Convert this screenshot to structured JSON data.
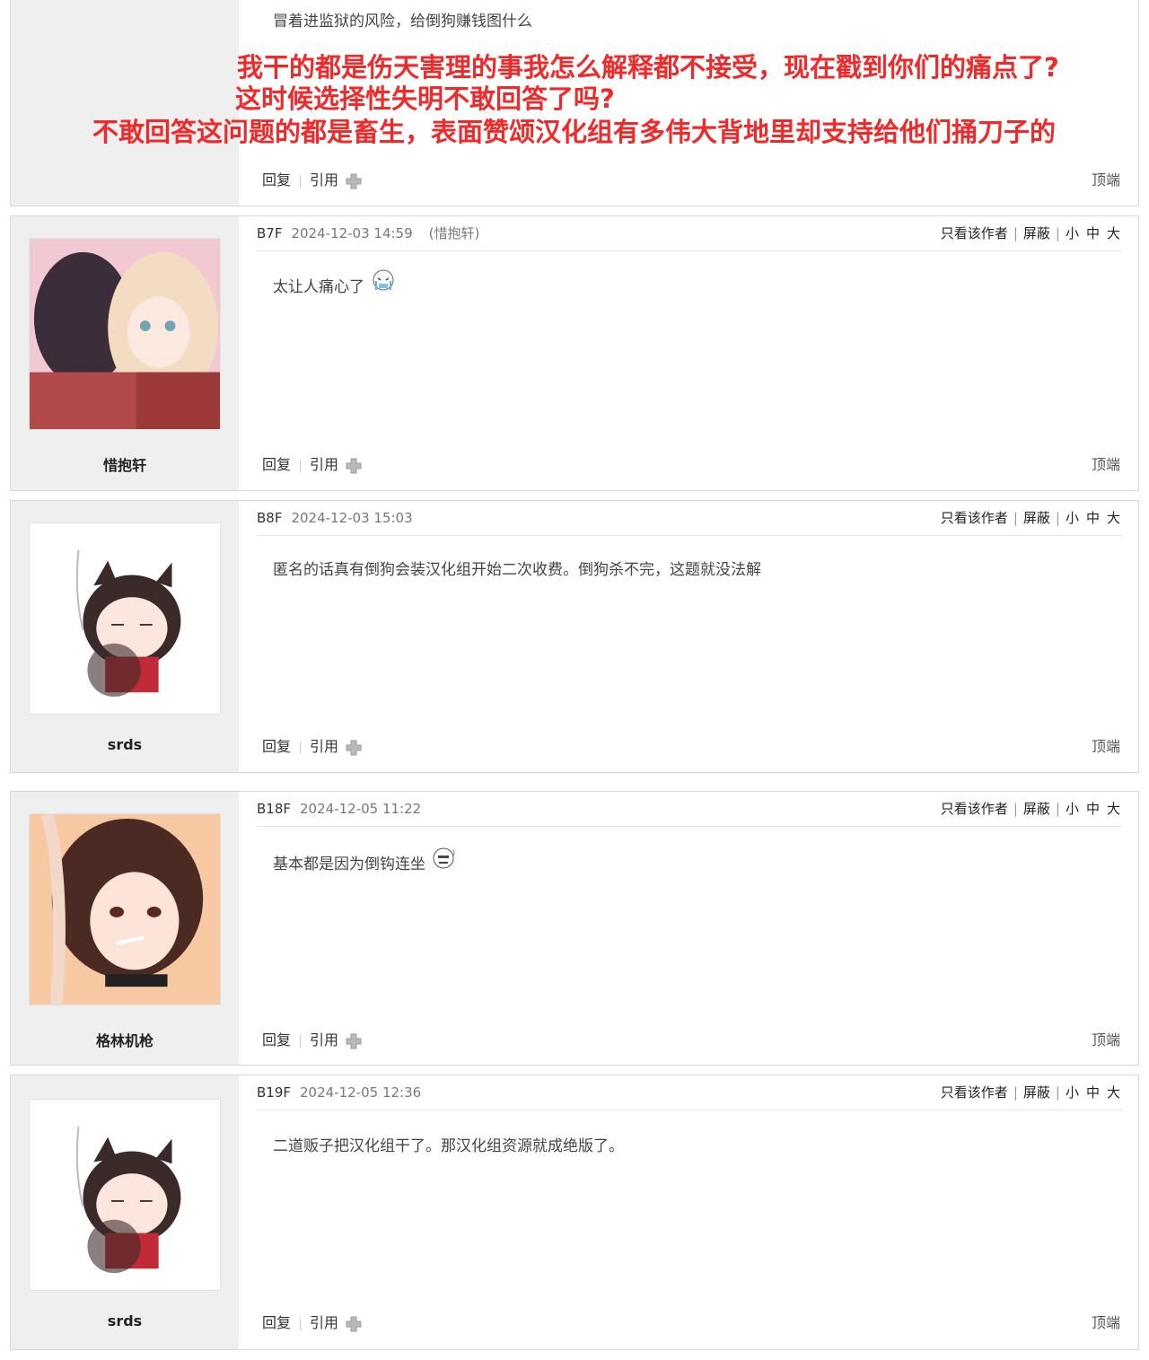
{
  "common": {
    "reply": "回复",
    "quote": "引用",
    "top": "顶端",
    "only_author": "只看该作者",
    "block": "屏蔽",
    "size_small": "小",
    "size_mid": "中",
    "size_big": "大"
  },
  "post0": {
    "content": "冒着进监狱的风险，给倒狗赚钱图什么",
    "overlay": [
      "我干的都是伤天害理的事我怎么解释都不接受，现在戳到你们的痛点了?",
      "这时候选择性失明不敢回答了吗?",
      "不敢回答这问题的都是畜生，表面赞颂汉化组有多伟大背地里却支持给他们捅刀子的"
    ]
  },
  "posts": [
    {
      "floor": "B7F",
      "time": "2024-12-03 14:59",
      "nick": "(惜抱轩)",
      "user": "惜抱轩",
      "content": "太让人痛心了"
    },
    {
      "floor": "B8F",
      "time": "2024-12-03 15:03",
      "nick": "",
      "user": "srds",
      "content": "匿名的话真有倒狗会装汉化组开始二次收费。倒狗杀不完，这题就没法解"
    },
    {
      "floor": "B18F",
      "time": "2024-12-05 11:22",
      "nick": "",
      "user": "格林机枪",
      "content": "基本都是因为倒钩连坐"
    },
    {
      "floor": "B19F",
      "time": "2024-12-05 12:36",
      "nick": "",
      "user": "srds",
      "content": "二道贩子把汉化组干了。那汉化组资源就成绝版了。"
    }
  ],
  "colors": {
    "accent_red": "#ef2a2a",
    "sidebar_bg": "#efefef",
    "border": "#d6d6d6"
  }
}
